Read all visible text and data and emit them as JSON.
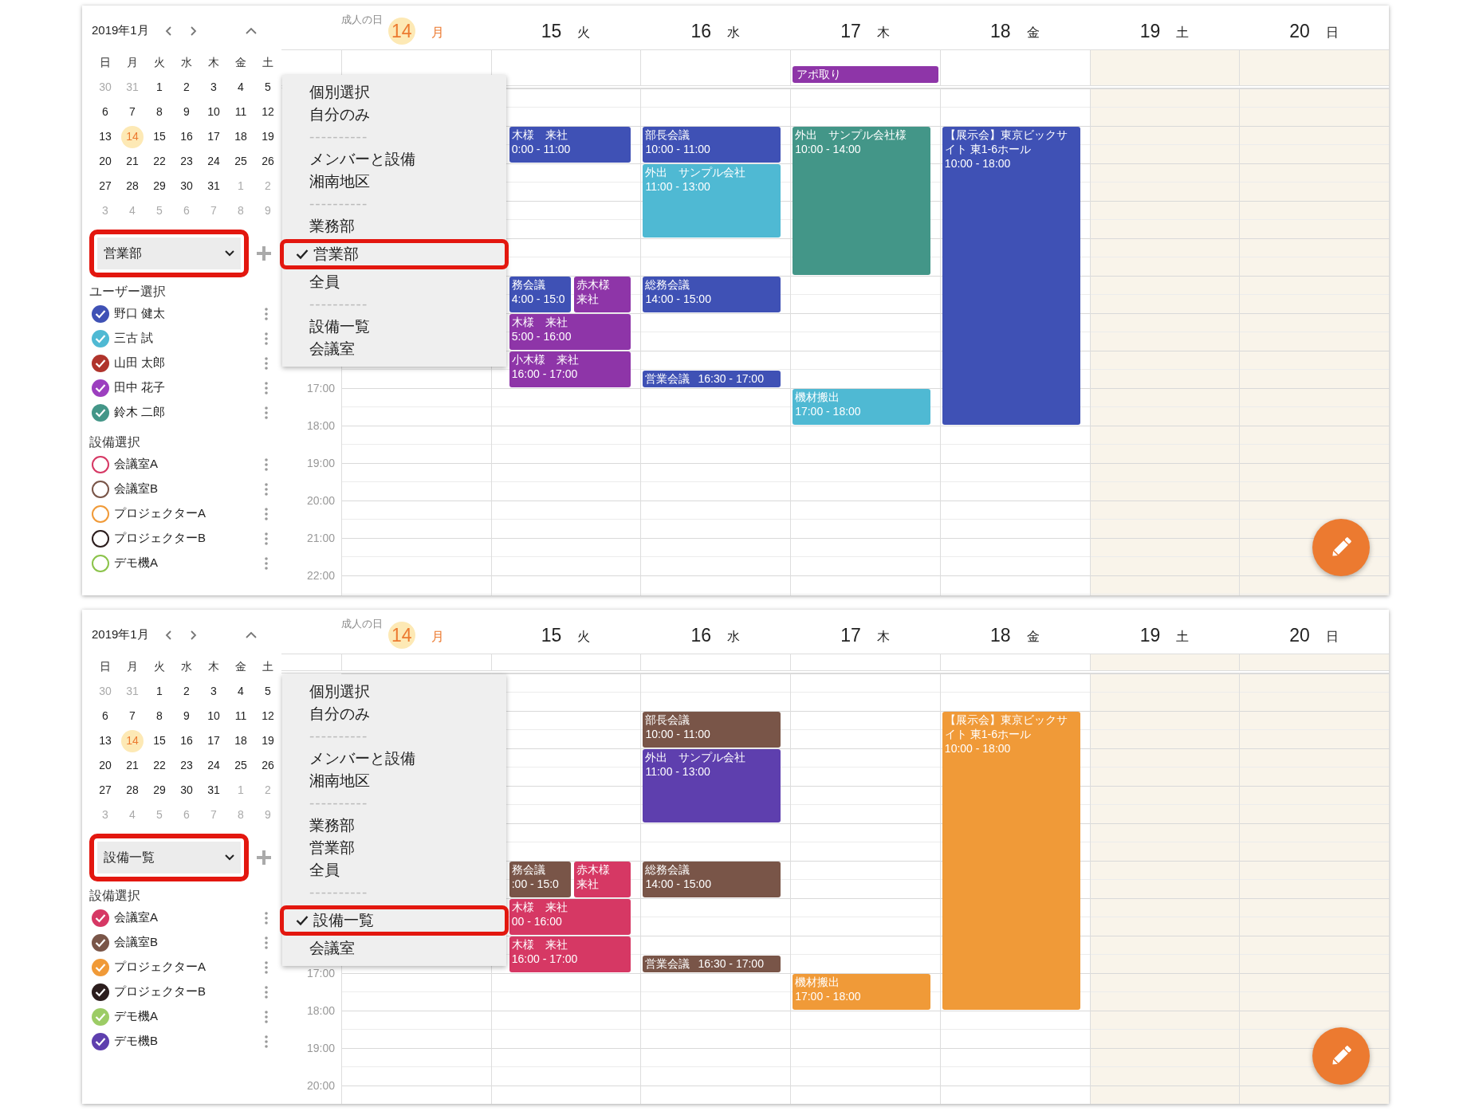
{
  "panels": [
    {
      "mini_calendar": {
        "title": "2019年1月",
        "weekdays": [
          "日",
          "月",
          "火",
          "水",
          "木",
          "金",
          "土"
        ],
        "days": [
          {
            "label": "30",
            "outside_month": true,
            "selected": false
          },
          {
            "label": "31",
            "outside_month": true,
            "selected": false
          },
          {
            "label": "1",
            "outside_month": false,
            "selected": false
          },
          {
            "label": "2",
            "outside_month": false,
            "selected": false
          },
          {
            "label": "3",
            "outside_month": false,
            "selected": false
          },
          {
            "label": "4",
            "outside_month": false,
            "selected": false
          },
          {
            "label": "5",
            "outside_month": false,
            "selected": false
          },
          {
            "label": "6",
            "outside_month": false,
            "selected": false
          },
          {
            "label": "7",
            "outside_month": false,
            "selected": false
          },
          {
            "label": "8",
            "outside_month": false,
            "selected": false
          },
          {
            "label": "9",
            "outside_month": false,
            "selected": false
          },
          {
            "label": "10",
            "outside_month": false,
            "selected": false
          },
          {
            "label": "11",
            "outside_month": false,
            "selected": false
          },
          {
            "label": "12",
            "outside_month": false,
            "selected": false
          },
          {
            "label": "13",
            "outside_month": false,
            "selected": false
          },
          {
            "label": "14",
            "outside_month": false,
            "selected": true
          },
          {
            "label": "15",
            "outside_month": false,
            "selected": false
          },
          {
            "label": "16",
            "outside_month": false,
            "selected": false
          },
          {
            "label": "17",
            "outside_month": false,
            "selected": false
          },
          {
            "label": "18",
            "outside_month": false,
            "selected": false
          },
          {
            "label": "19",
            "outside_month": false,
            "selected": false
          },
          {
            "label": "20",
            "outside_month": false,
            "selected": false
          },
          {
            "label": "21",
            "outside_month": false,
            "selected": false
          },
          {
            "label": "22",
            "outside_month": false,
            "selected": false
          },
          {
            "label": "23",
            "outside_month": false,
            "selected": false
          },
          {
            "label": "24",
            "outside_month": false,
            "selected": false
          },
          {
            "label": "25",
            "outside_month": false,
            "selected": false
          },
          {
            "label": "26",
            "outside_month": false,
            "selected": false
          },
          {
            "label": "27",
            "outside_month": false,
            "selected": false
          },
          {
            "label": "28",
            "outside_month": false,
            "selected": false
          },
          {
            "label": "29",
            "outside_month": false,
            "selected": false
          },
          {
            "label": "30",
            "outside_month": false,
            "selected": false
          },
          {
            "label": "31",
            "outside_month": false,
            "selected": false
          },
          {
            "label": "1",
            "outside_month": true,
            "selected": false
          },
          {
            "label": "2",
            "outside_month": true,
            "selected": false
          },
          {
            "label": "3",
            "outside_month": true,
            "selected": false
          },
          {
            "label": "4",
            "outside_month": true,
            "selected": false
          },
          {
            "label": "5",
            "outside_month": true,
            "selected": false
          },
          {
            "label": "6",
            "outside_month": true,
            "selected": false
          },
          {
            "label": "7",
            "outside_month": true,
            "selected": false
          },
          {
            "label": "8",
            "outside_month": true,
            "selected": false
          },
          {
            "label": "9",
            "outside_month": true,
            "selected": false
          }
        ]
      },
      "group_select": {
        "value": "営業部",
        "highlighted": true
      },
      "sections": [
        {
          "title": "ユーザー選択",
          "items": [
            {
              "label": "野口 健太",
              "color": "#3f51b5",
              "checked": true
            },
            {
              "label": "三古 試",
              "color": "#4fb9d3",
              "checked": true
            },
            {
              "label": "山田 太郎",
              "color": "#b0342c",
              "checked": true
            },
            {
              "label": "田中 花子",
              "color": "#9c3fbf",
              "checked": true
            },
            {
              "label": "鈴木 二郎",
              "color": "#439688",
              "checked": true
            }
          ]
        },
        {
          "title": "設備選択",
          "items": [
            {
              "label": "会議室A",
              "color": "#d63864",
              "checked": false
            },
            {
              "label": "会議室B",
              "color": "#795548",
              "checked": false
            },
            {
              "label": "プロジェクターA",
              "color": "#f09a38",
              "checked": false
            },
            {
              "label": "プロジェクターB",
              "color": "#2b1d1d",
              "checked": false
            },
            {
              "label": "デモ機A",
              "color": "#8bc34a",
              "checked": false
            }
          ]
        }
      ],
      "menu": {
        "items": [
          {
            "kind": "option",
            "label": "個別選択",
            "selected": false,
            "highlighted": false
          },
          {
            "kind": "option",
            "label": "自分のみ",
            "selected": false,
            "highlighted": false
          },
          {
            "kind": "separator",
            "label": "----------"
          },
          {
            "kind": "option",
            "label": "メンバーと設備",
            "selected": false,
            "highlighted": false
          },
          {
            "kind": "option",
            "label": "湘南地区",
            "selected": false,
            "highlighted": false
          },
          {
            "kind": "separator",
            "label": "----------"
          },
          {
            "kind": "option",
            "label": "業務部",
            "selected": false,
            "highlighted": false
          },
          {
            "kind": "option",
            "label": "営業部",
            "selected": true,
            "highlighted": true
          },
          {
            "kind": "option",
            "label": "全員",
            "selected": false,
            "highlighted": false
          },
          {
            "kind": "separator",
            "label": "----------"
          },
          {
            "kind": "option",
            "label": "設備一覧",
            "selected": false,
            "highlighted": false
          },
          {
            "kind": "option",
            "label": "会議室",
            "selected": false,
            "highlighted": false
          }
        ]
      },
      "days": [
        {
          "date": "14",
          "weekday": "月",
          "holiday": "成人の日",
          "today": true,
          "weekend": false
        },
        {
          "date": "15",
          "weekday": "火",
          "today": false,
          "weekend": false,
          "events": [
            {
              "title": "木様　来社",
              "time": "0:00 - 11:00",
              "color": "#3f51b5"
            },
            {
              "title": "務会議",
              "time": "4:00 - 15:0",
              "color": "#3f51b5"
            },
            {
              "title": "赤木様来社",
              "color": "#8e35a8"
            },
            {
              "title": "木様　来社",
              "time": "5:00 - 16:00",
              "color": "#8e35a8"
            },
            {
              "title": "小木様　来社",
              "time": "16:00 - 17:00",
              "color": "#8e35a8"
            }
          ]
        },
        {
          "date": "16",
          "weekday": "水",
          "today": false,
          "weekend": false,
          "events": [
            {
              "title": "部長会議",
              "time": "10:00 - 11:00",
              "color": "#3f51b5"
            },
            {
              "title": "外出　サンプル会社",
              "time": "11:00 - 13:00",
              "color": "#4fb9d3"
            },
            {
              "title": "総務会議",
              "time": "14:00 - 15:00",
              "color": "#3f51b5"
            },
            {
              "title": "営業会議",
              "time": "16:30 - 17:00",
              "color": "#3f51b5"
            }
          ]
        },
        {
          "date": "17",
          "weekday": "木",
          "today": false,
          "weekend": false,
          "all_day": [
            {
              "title": "アポ取り",
              "color": "#8e35a8"
            }
          ],
          "events": [
            {
              "title": "外出　サンプル会社様",
              "time": "10:00 - 14:00",
              "color": "#439688"
            },
            {
              "title": "機材搬出",
              "time": "17:00 - 18:00",
              "color": "#4fb9d3"
            }
          ]
        },
        {
          "date": "18",
          "weekday": "金",
          "today": false,
          "weekend": false,
          "events": [
            {
              "title": "【展示会】東京ビックサイト 東1-6ホール",
              "time": "10:00 - 18:00",
              "color": "#3f51b5"
            }
          ]
        },
        {
          "date": "19",
          "weekday": "土",
          "today": false,
          "weekend": true
        },
        {
          "date": "20",
          "weekday": "日",
          "today": false,
          "weekend": true
        }
      ],
      "time_labels": [
        "17:00",
        "18:00",
        "19:00",
        "20:00",
        "21:00",
        "22:00"
      ]
    },
    {
      "mini_calendar": {
        "title": "2019年1月",
        "weekdays": [
          "日",
          "月",
          "火",
          "水",
          "木",
          "金",
          "土"
        ],
        "days": [
          {
            "label": "30",
            "outside_month": true,
            "selected": false
          },
          {
            "label": "31",
            "outside_month": true,
            "selected": false
          },
          {
            "label": "1",
            "outside_month": false,
            "selected": false
          },
          {
            "label": "2",
            "outside_month": false,
            "selected": false
          },
          {
            "label": "3",
            "outside_month": false,
            "selected": false
          },
          {
            "label": "4",
            "outside_month": false,
            "selected": false
          },
          {
            "label": "5",
            "outside_month": false,
            "selected": false
          },
          {
            "label": "6",
            "outside_month": false,
            "selected": false
          },
          {
            "label": "7",
            "outside_month": false,
            "selected": false
          },
          {
            "label": "8",
            "outside_month": false,
            "selected": false
          },
          {
            "label": "9",
            "outside_month": false,
            "selected": false
          },
          {
            "label": "10",
            "outside_month": false,
            "selected": false
          },
          {
            "label": "11",
            "outside_month": false,
            "selected": false
          },
          {
            "label": "12",
            "outside_month": false,
            "selected": false
          },
          {
            "label": "13",
            "outside_month": false,
            "selected": false
          },
          {
            "label": "14",
            "outside_month": false,
            "selected": true
          },
          {
            "label": "15",
            "outside_month": false,
            "selected": false
          },
          {
            "label": "16",
            "outside_month": false,
            "selected": false
          },
          {
            "label": "17",
            "outside_month": false,
            "selected": false
          },
          {
            "label": "18",
            "outside_month": false,
            "selected": false
          },
          {
            "label": "19",
            "outside_month": false,
            "selected": false
          },
          {
            "label": "20",
            "outside_month": false,
            "selected": false
          },
          {
            "label": "21",
            "outside_month": false,
            "selected": false
          },
          {
            "label": "22",
            "outside_month": false,
            "selected": false
          },
          {
            "label": "23",
            "outside_month": false,
            "selected": false
          },
          {
            "label": "24",
            "outside_month": false,
            "selected": false
          },
          {
            "label": "25",
            "outside_month": false,
            "selected": false
          },
          {
            "label": "26",
            "outside_month": false,
            "selected": false
          },
          {
            "label": "27",
            "outside_month": false,
            "selected": false
          },
          {
            "label": "28",
            "outside_month": false,
            "selected": false
          },
          {
            "label": "29",
            "outside_month": false,
            "selected": false
          },
          {
            "label": "30",
            "outside_month": false,
            "selected": false
          },
          {
            "label": "31",
            "outside_month": false,
            "selected": false
          },
          {
            "label": "1",
            "outside_month": true,
            "selected": false
          },
          {
            "label": "2",
            "outside_month": true,
            "selected": false
          },
          {
            "label": "3",
            "outside_month": true,
            "selected": false
          },
          {
            "label": "4",
            "outside_month": true,
            "selected": false
          },
          {
            "label": "5",
            "outside_month": true,
            "selected": false
          },
          {
            "label": "6",
            "outside_month": true,
            "selected": false
          },
          {
            "label": "7",
            "outside_month": true,
            "selected": false
          },
          {
            "label": "8",
            "outside_month": true,
            "selected": false
          },
          {
            "label": "9",
            "outside_month": true,
            "selected": false
          }
        ]
      },
      "group_select": {
        "value": "設備一覧",
        "highlighted": true
      },
      "sections": [
        {
          "title": "設備選択",
          "items": [
            {
              "label": "会議室A",
              "color": "#d63864",
              "checked": true
            },
            {
              "label": "会議室B",
              "color": "#795548",
              "checked": true
            },
            {
              "label": "プロジェクターA",
              "color": "#f09a38",
              "checked": true
            },
            {
              "label": "プロジェクターB",
              "color": "#2b1d1d",
              "checked": true
            },
            {
              "label": "デモ機A",
              "color": "#9ccc65",
              "checked": true
            },
            {
              "label": "デモ機B",
              "color": "#5e3fae",
              "checked": true
            }
          ]
        }
      ],
      "menu": {
        "items": [
          {
            "kind": "option",
            "label": "個別選択",
            "selected": false,
            "highlighted": false
          },
          {
            "kind": "option",
            "label": "自分のみ",
            "selected": false,
            "highlighted": false
          },
          {
            "kind": "separator",
            "label": "----------"
          },
          {
            "kind": "option",
            "label": "メンバーと設備",
            "selected": false,
            "highlighted": false
          },
          {
            "kind": "option",
            "label": "湘南地区",
            "selected": false,
            "highlighted": false
          },
          {
            "kind": "separator",
            "label": "----------"
          },
          {
            "kind": "option",
            "label": "業務部",
            "selected": false,
            "highlighted": false
          },
          {
            "kind": "option",
            "label": "営業部",
            "selected": false,
            "highlighted": false
          },
          {
            "kind": "option",
            "label": "全員",
            "selected": false,
            "highlighted": false
          },
          {
            "kind": "separator",
            "label": "----------"
          },
          {
            "kind": "option",
            "label": "設備一覧",
            "selected": true,
            "highlighted": true
          },
          {
            "kind": "option",
            "label": "会議室",
            "selected": false,
            "highlighted": false
          }
        ]
      },
      "days": [
        {
          "date": "14",
          "weekday": "月",
          "holiday": "成人の日",
          "today": true,
          "weekend": false
        },
        {
          "date": "15",
          "weekday": "火",
          "today": false,
          "weekend": false,
          "events": [
            {
              "title": "務会議",
              "time": ":00 - 15:0",
              "color": "#795548"
            },
            {
              "title": "赤木様来社",
              "color": "#d63864"
            },
            {
              "title": "木様　来社",
              "time": "00 - 16:00",
              "color": "#d63864"
            },
            {
              "title": "木様　来社",
              "time": "16:00 - 17:00",
              "color": "#d63864"
            }
          ]
        },
        {
          "date": "16",
          "weekday": "水",
          "today": false,
          "weekend": false,
          "events": [
            {
              "title": "部長会議",
              "time": "10:00 - 11:00",
              "color": "#795548"
            },
            {
              "title": "外出　サンプル会社",
              "time": "11:00 - 13:00",
              "color": "#5e3fae"
            },
            {
              "title": "総務会議",
              "time": "14:00 - 15:00",
              "color": "#795548"
            },
            {
              "title": "営業会議",
              "time": "16:30 - 17:00",
              "color": "#795548"
            }
          ]
        },
        {
          "date": "17",
          "weekday": "木",
          "today": false,
          "weekend": false,
          "events": [
            {
              "title": "機材搬出",
              "time": "17:00 - 18:00",
              "color": "#f09a38"
            }
          ]
        },
        {
          "date": "18",
          "weekday": "金",
          "today": false,
          "weekend": false,
          "events": [
            {
              "title": "【展示会】東京ビックサイト 東1-6ホール",
              "time": "10:00 - 18:00",
              "color": "#f09a38"
            }
          ]
        },
        {
          "date": "19",
          "weekday": "土",
          "today": false,
          "weekend": true
        },
        {
          "date": "20",
          "weekday": "日",
          "today": false,
          "weekend": true
        }
      ],
      "time_labels": [
        "17:00",
        "18:00",
        "19:00",
        "20:00"
      ]
    }
  ]
}
